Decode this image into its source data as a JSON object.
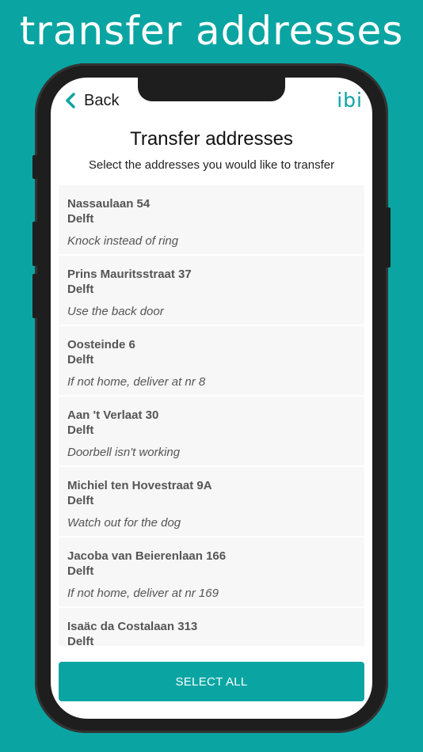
{
  "banner": {
    "title": "transfer addresses"
  },
  "nav": {
    "back_label": "Back",
    "logo_text": "ibi"
  },
  "page": {
    "title": "Transfer addresses",
    "subtitle": "Select the addresses you would like to transfer"
  },
  "addresses": [
    {
      "street": "Nassaulaan 54",
      "city": "Delft",
      "note": "Knock instead of ring"
    },
    {
      "street": "Prins Mauritsstraat 37",
      "city": "Delft",
      "note": "Use the back door"
    },
    {
      "street": "Oosteinde 6",
      "city": "Delft",
      "note": "If not home, deliver at nr 8"
    },
    {
      "street": "Aan 't Verlaat 30",
      "city": "Delft",
      "note": "Doorbell isn't working"
    },
    {
      "street": "Michiel ten Hovestraat 9A",
      "city": "Delft",
      "note": "Watch out for the dog"
    },
    {
      "street": "Jacoba van Beierenlaan 166",
      "city": "Delft",
      "note": "If not home, deliver at nr 169"
    },
    {
      "street": "Isaäc da Costalaan 313",
      "city": "Delft",
      "note": ""
    }
  ],
  "actions": {
    "select_all_label": "SELECT ALL"
  },
  "colors": {
    "accent": "#0aa5a2",
    "frame": "#1e1e1e",
    "card": "#f7f7f7"
  }
}
